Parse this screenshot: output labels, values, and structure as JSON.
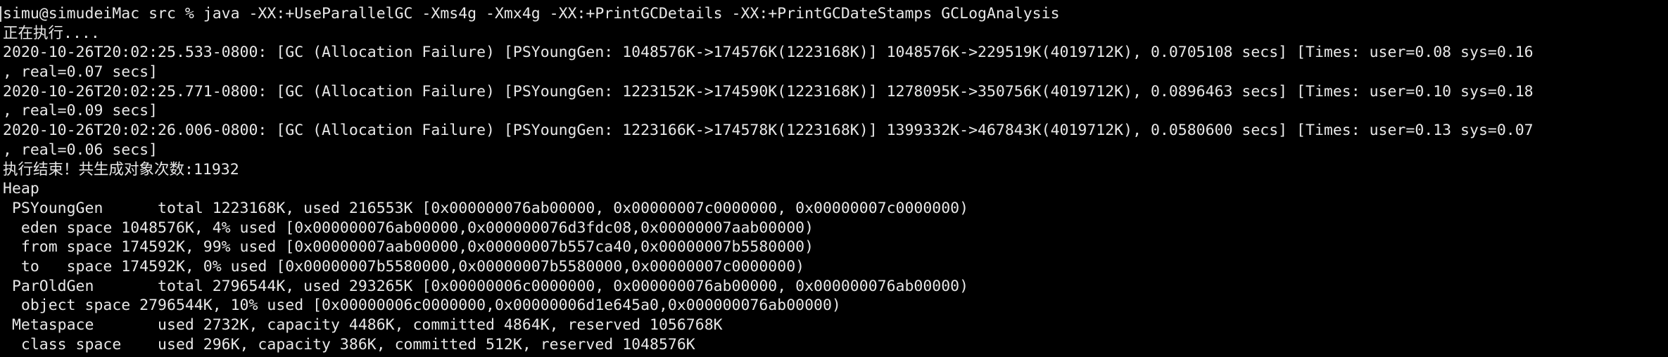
{
  "terminal": {
    "lines": [
      "simu@simudeiMac src % java -XX:+UseParallelGC -Xms4g -Xmx4g -XX:+PrintGCDetails -XX:+PrintGCDateStamps GCLogAnalysis",
      "正在执行....",
      "2020-10-26T20:02:25.533-0800: [GC (Allocation Failure) [PSYoungGen: 1048576K->174576K(1223168K)] 1048576K->229519K(4019712K), 0.0705108 secs] [Times: user=0.08 sys=0.16",
      ", real=0.07 secs]",
      "2020-10-26T20:02:25.771-0800: [GC (Allocation Failure) [PSYoungGen: 1223152K->174590K(1223168K)] 1278095K->350756K(4019712K), 0.0896463 secs] [Times: user=0.10 sys=0.18",
      ", real=0.09 secs]",
      "2020-10-26T20:02:26.006-0800: [GC (Allocation Failure) [PSYoungGen: 1223166K->174578K(1223168K)] 1399332K->467843K(4019712K), 0.0580600 secs] [Times: user=0.13 sys=0.07",
      ", real=0.06 secs]",
      "执行结束！共生成对象次数:11932",
      "Heap",
      " PSYoungGen      total 1223168K, used 216553K [0x000000076ab00000, 0x00000007c0000000, 0x00000007c0000000)",
      "  eden space 1048576K, 4% used [0x000000076ab00000,0x000000076d3fdc08,0x00000007aab00000)",
      "  from space 174592K, 99% used [0x00000007aab00000,0x00000007b557ca40,0x00000007b5580000)",
      "  to   space 174592K, 0% used [0x00000007b5580000,0x00000007b5580000,0x00000007c0000000)",
      " ParOldGen       total 2796544K, used 293265K [0x00000006c0000000, 0x000000076ab00000, 0x000000076ab00000)",
      "  object space 2796544K, 10% used [0x00000006c0000000,0x00000006d1e645a0,0x000000076ab00000)",
      " Metaspace       used 2732K, capacity 4486K, committed 4864K, reserved 1056768K",
      "  class space    used 296K, capacity 386K, committed 512K, reserved 1048576K"
    ]
  }
}
